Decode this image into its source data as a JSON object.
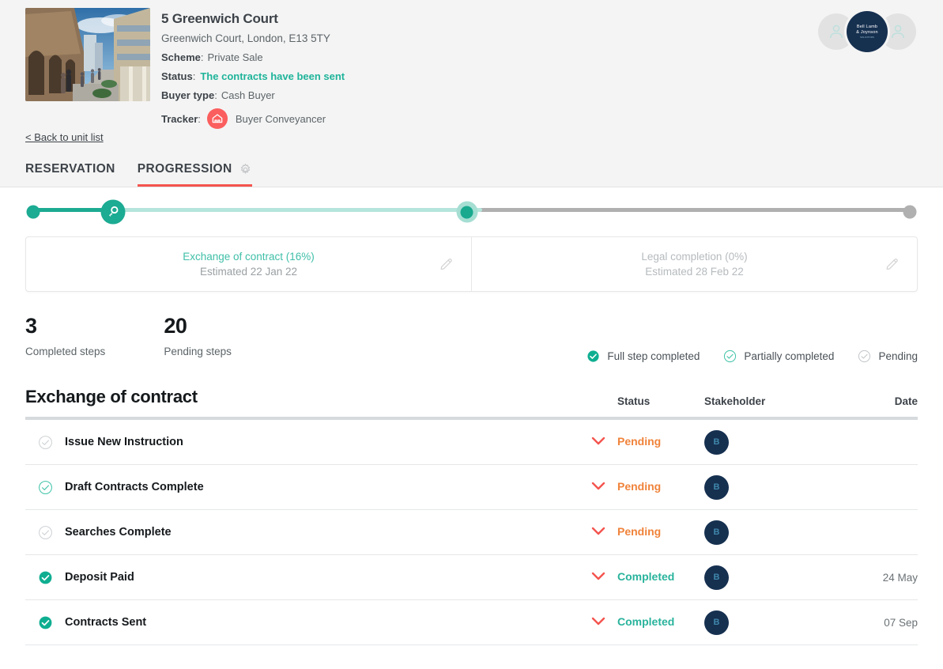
{
  "property": {
    "title": "5 Greenwich Court",
    "address": "Greenwich Court, London, E13 5TY",
    "scheme_label": "Scheme",
    "scheme_value": "Private Sale",
    "status_label": "Status",
    "status_value": "The contracts have been sent",
    "buyer_type_label": "Buyer type",
    "buyer_type_value": "Cash Buyer",
    "tracker_label": "Tracker",
    "tracker_value": "Buyer Conveyancer",
    "thumbnail_icon": "property-photo",
    "tracker_icon": "house-icon"
  },
  "avatars": {
    "left_icon": "user-avatar-icon",
    "right_icon": "user-avatar-icon",
    "brand_line1": "Bell Lamb",
    "brand_line2": "& Joynson",
    "brand_line3": "SOLICITORS"
  },
  "back_link": "< Back to unit list",
  "tabs": [
    {
      "label": "RESERVATION",
      "active": false
    },
    {
      "label": "PROGRESSION",
      "active": true
    }
  ],
  "tab_settings_icon": "gear-icon",
  "progress": {
    "nodes": [
      {
        "type": "dot",
        "position_pct": 0.9,
        "state": "complete"
      },
      {
        "type": "key",
        "position_pct": 9.8,
        "state": "complete",
        "icon": "key-icon"
      },
      {
        "type": "current",
        "position_pct": 49.5,
        "state": "current"
      },
      {
        "type": "dot",
        "position_pct": 99.1,
        "state": "pending"
      }
    ],
    "teal_fill_pct": 8,
    "light_teal_fill_pct": 50.3,
    "colors": {
      "complete": "#1cab93",
      "light": "#b5e5dc",
      "pending": "#b0b0b0"
    }
  },
  "milestones": [
    {
      "title": "Exchange of contract (16%)",
      "estimate": "Estimated 22 Jan 22",
      "muted": false,
      "edit_icon": "pencil-icon"
    },
    {
      "title": "Legal completion (0%)",
      "estimate": "Estimated 28 Feb 22",
      "muted": true,
      "edit_icon": "pencil-icon"
    }
  ],
  "stats": [
    {
      "number": "3",
      "label": "Completed steps"
    },
    {
      "number": "20",
      "label": "Pending steps"
    }
  ],
  "legend": [
    {
      "label": "Full step completed",
      "state": "full",
      "icon": "check-filled-icon"
    },
    {
      "label": "Partially completed",
      "state": "partial",
      "icon": "check-outline-teal-icon"
    },
    {
      "label": "Pending",
      "state": "pending",
      "icon": "check-outline-gray-icon"
    }
  ],
  "table": {
    "section_title": "Exchange of contract",
    "columns": {
      "status": "Status",
      "stakeholder": "Stakeholder",
      "date": "Date"
    },
    "rows": [
      {
        "name": "Issue New Instruction",
        "check": "pending",
        "status": "Pending",
        "status_state": "pending",
        "stakeholder": "B",
        "date": "",
        "chevron_icon": "chevron-down-icon"
      },
      {
        "name": "Draft Contracts Complete",
        "check": "partial",
        "status": "Pending",
        "status_state": "pending",
        "stakeholder": "B",
        "date": "",
        "chevron_icon": "chevron-down-icon"
      },
      {
        "name": "Searches Complete",
        "check": "pending",
        "status": "Pending",
        "status_state": "pending",
        "stakeholder": "B",
        "date": "",
        "chevron_icon": "chevron-down-icon"
      },
      {
        "name": "Deposit Paid",
        "check": "full",
        "status": "Completed",
        "status_state": "completed",
        "stakeholder": "B",
        "date": "24 May",
        "chevron_icon": "chevron-down-icon"
      },
      {
        "name": "Contracts Sent",
        "check": "full",
        "status": "Completed",
        "status_state": "completed",
        "stakeholder": "B",
        "date": "07 Sep",
        "chevron_icon": "chevron-down-icon"
      }
    ]
  },
  "colors": {
    "teal": "#1cab93",
    "coral": "#f4544f",
    "orange": "#f0833b",
    "navy": "#163050",
    "header_bg": "#f4f4f4"
  }
}
